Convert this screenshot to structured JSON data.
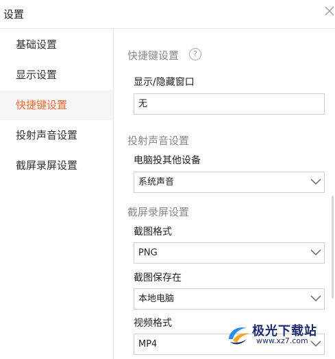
{
  "window": {
    "title": "设置"
  },
  "sidebar": {
    "items": [
      {
        "label": "基础设置"
      },
      {
        "label": "显示设置"
      },
      {
        "label": "快捷键设置"
      },
      {
        "label": "投射声音设置"
      },
      {
        "label": "截屏录屏设置"
      }
    ],
    "active_index": 2
  },
  "shortcut": {
    "title": "快捷键设置",
    "help_glyph": "?",
    "toggle_label": "显示/隐藏窗口",
    "toggle_value": "无"
  },
  "cast_audio": {
    "title": "投射声音设置",
    "device_label": "电脑投其他设备",
    "device_value": "系统声音"
  },
  "capture": {
    "title": "截屏录屏设置",
    "format_label": "截图格式",
    "format_value": "PNG",
    "save_label": "截图保存在",
    "save_value": "本地电脑",
    "video_label": "视频格式",
    "video_value": "MP4"
  },
  "watermark": {
    "brand": "极光下载站",
    "url": "www.xz7.com"
  },
  "colors": {
    "accent": "#f06a35",
    "section": "#8a8a8a",
    "border": "#cfcfcf"
  }
}
